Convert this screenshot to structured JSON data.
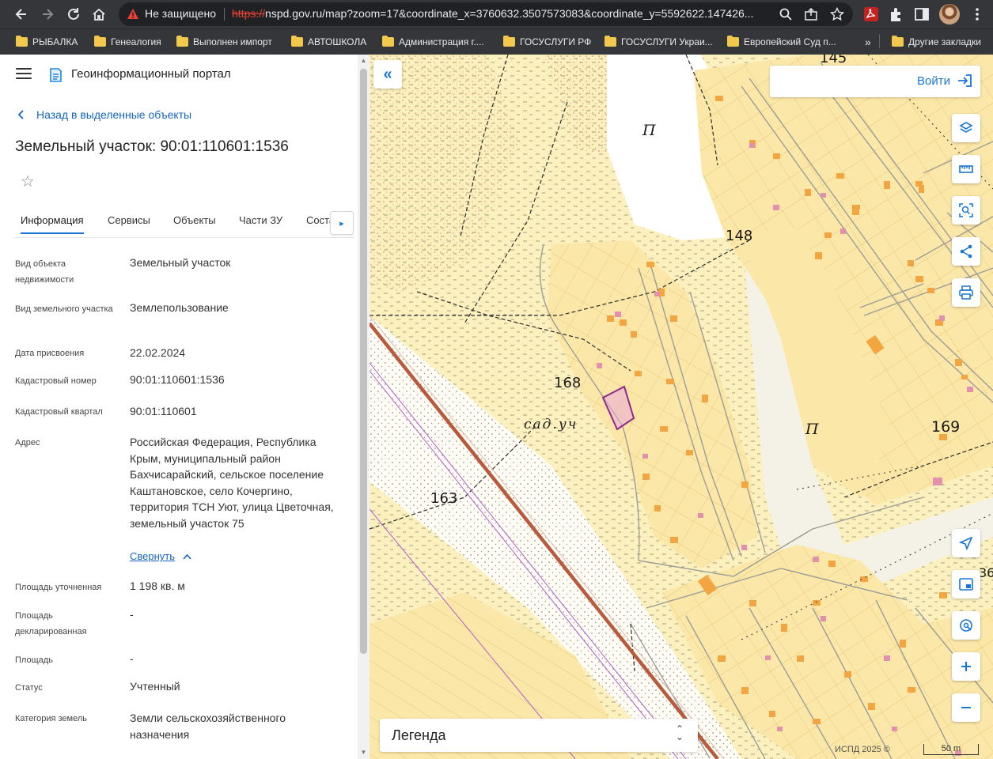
{
  "browser": {
    "insecure_label": "Не защищено",
    "url_scheme": "https://",
    "url_rest": "nspd.gov.ru/map?zoom=17&coordinate_x=3760632.3507573083&coordinate_y=5592622.147426...",
    "bookmarks": [
      "РЫБАЛКА",
      "Генеалогия",
      "Выполнен импорт",
      "АВТОШКОЛА",
      "Администрация г....",
      "ГОСУСЛУГИ РФ",
      "ГОСУСЛУГИ Украи...",
      "Европейский Суд п..."
    ],
    "bookmarks_overflow": "»",
    "other_bookmarks": "Другие закладки"
  },
  "panel": {
    "portal_title": "Геоинформационный портал",
    "back_label": "Назад в выделенные объекты",
    "title": "Земельный участок: 90:01:110601:1536",
    "tabs": [
      "Информация",
      "Сервисы",
      "Объекты",
      "Части ЗУ",
      "Соста"
    ],
    "collapse_label": "Свернуть",
    "attributes": [
      {
        "label": "Вид объекта недвижимости",
        "value": "Земельный участок"
      },
      {
        "label": "Вид земельного участка",
        "value": "Землепользование"
      },
      {
        "label": "Дата присвоения",
        "value": "22.02.2024"
      },
      {
        "label": "Кадастровый номер",
        "value": "90:01:110601:1536"
      },
      {
        "label": "Кадастровый квартал",
        "value": "90:01:110601"
      },
      {
        "label": "Адрес",
        "value": "Российская Федерация, Республика Крым, муниципальный район Бахчисарайский, сельское поселение Каштановское, село Кочергино, территория ТСН Уют, улица Цветочная, земельный участок 75"
      },
      {
        "label": "Площадь уточненная",
        "value": "1 198 кв. м"
      },
      {
        "label": "Площадь декларированная",
        "value": "-"
      },
      {
        "label": "Площадь",
        "value": "-"
      },
      {
        "label": "Статус",
        "value": "Учтенный"
      },
      {
        "label": "Категория земель",
        "value": "Земли сельскохозяйственного назначения"
      }
    ]
  },
  "map": {
    "login_label": "Войти",
    "legend_label": "Легенда",
    "attribution": "ИСПД 2025 ©",
    "scale_label": "50 m",
    "labels": {
      "e145": "145",
      "e148": "148",
      "e168": "168",
      "e163": "163",
      "e169": "169",
      "p1": "П",
      "p2": "П",
      "garden": "сад.уч",
      "edge": "36"
    }
  },
  "colors": {
    "map_base": "#fcf1be",
    "plot_fill": "#fbe7a8",
    "building": "#f2a541",
    "building_pink": "#e58fae",
    "selected_parcel": "#8e2a8e",
    "railway": "#b85a3c",
    "accent": "#1976d2"
  }
}
